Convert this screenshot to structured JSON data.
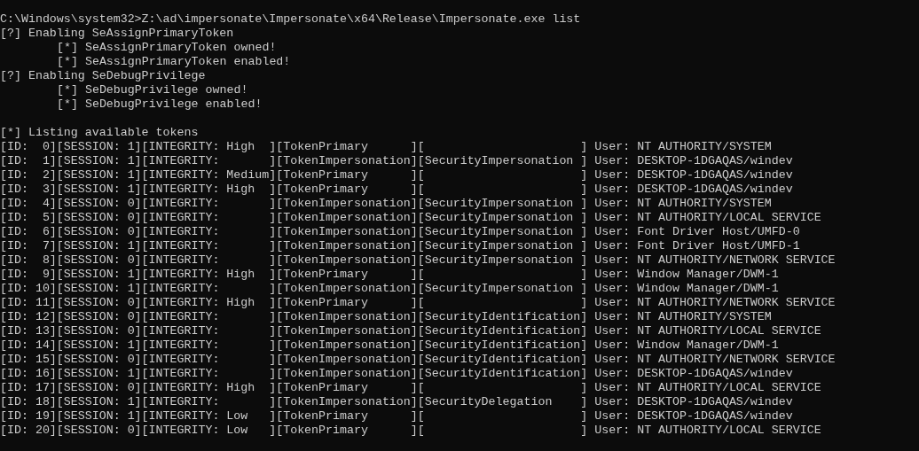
{
  "console": {
    "blocks": [
      {
        "lines": [
          {
            "text": "C:\\Windows\\system32>Z:\\ad\\impersonate\\Impersonate\\x64\\Release\\Impersonate.exe list",
            "indented": false
          },
          {
            "text": "[?] Enabling SeAssignPrimaryToken",
            "indented": false
          },
          {
            "text": "[*] SeAssignPrimaryToken owned!",
            "indented": true
          },
          {
            "text": "[*] SeAssignPrimaryToken enabled!",
            "indented": true
          },
          {
            "text": "[?] Enabling SeDebugPrivilege",
            "indented": false
          },
          {
            "text": "[*] SeDebugPrivilege owned!",
            "indented": true
          },
          {
            "text": "[*] SeDebugPrivilege enabled!",
            "indented": true
          }
        ]
      },
      {
        "lines": [
          {
            "text": "[*] Listing available tokens",
            "indented": false
          },
          {
            "text": "[ID:  0][SESSION: 1][INTEGRITY: High  ][TokenPrimary      ][                      ] User: NT AUTHORITY/SYSTEM",
            "indented": false
          },
          {
            "text": "[ID:  1][SESSION: 1][INTEGRITY:       ][TokenImpersonation][SecurityImpersonation ] User: DESKTOP-1DGAQAS/windev",
            "indented": false
          },
          {
            "text": "[ID:  2][SESSION: 1][INTEGRITY: Medium][TokenPrimary      ][                      ] User: DESKTOP-1DGAQAS/windev",
            "indented": false
          },
          {
            "text": "[ID:  3][SESSION: 1][INTEGRITY: High  ][TokenPrimary      ][                      ] User: DESKTOP-1DGAQAS/windev",
            "indented": false
          },
          {
            "text": "[ID:  4][SESSION: 0][INTEGRITY:       ][TokenImpersonation][SecurityImpersonation ] User: NT AUTHORITY/SYSTEM",
            "indented": false
          },
          {
            "text": "[ID:  5][SESSION: 0][INTEGRITY:       ][TokenImpersonation][SecurityImpersonation ] User: NT AUTHORITY/LOCAL SERVICE",
            "indented": false
          },
          {
            "text": "[ID:  6][SESSION: 0][INTEGRITY:       ][TokenImpersonation][SecurityImpersonation ] User: Font Driver Host/UMFD-0",
            "indented": false
          },
          {
            "text": "[ID:  7][SESSION: 1][INTEGRITY:       ][TokenImpersonation][SecurityImpersonation ] User: Font Driver Host/UMFD-1",
            "indented": false
          },
          {
            "text": "[ID:  8][SESSION: 0][INTEGRITY:       ][TokenImpersonation][SecurityImpersonation ] User: NT AUTHORITY/NETWORK SERVICE",
            "indented": false
          },
          {
            "text": "[ID:  9][SESSION: 1][INTEGRITY: High  ][TokenPrimary      ][                      ] User: Window Manager/DWM-1",
            "indented": false
          },
          {
            "text": "[ID: 10][SESSION: 1][INTEGRITY:       ][TokenImpersonation][SecurityImpersonation ] User: Window Manager/DWM-1",
            "indented": false
          },
          {
            "text": "[ID: 11][SESSION: 0][INTEGRITY: High  ][TokenPrimary      ][                      ] User: NT AUTHORITY/NETWORK SERVICE",
            "indented": false
          },
          {
            "text": "[ID: 12][SESSION: 0][INTEGRITY:       ][TokenImpersonation][SecurityIdentification] User: NT AUTHORITY/SYSTEM",
            "indented": false
          },
          {
            "text": "[ID: 13][SESSION: 0][INTEGRITY:       ][TokenImpersonation][SecurityIdentification] User: NT AUTHORITY/LOCAL SERVICE",
            "indented": false
          },
          {
            "text": "[ID: 14][SESSION: 1][INTEGRITY:       ][TokenImpersonation][SecurityIdentification] User: Window Manager/DWM-1",
            "indented": false
          },
          {
            "text": "[ID: 15][SESSION: 0][INTEGRITY:       ][TokenImpersonation][SecurityIdentification] User: NT AUTHORITY/NETWORK SERVICE",
            "indented": false
          },
          {
            "text": "[ID: 16][SESSION: 1][INTEGRITY:       ][TokenImpersonation][SecurityIdentification] User: DESKTOP-1DGAQAS/windev",
            "indented": false
          },
          {
            "text": "[ID: 17][SESSION: 0][INTEGRITY: High  ][TokenPrimary      ][                      ] User: NT AUTHORITY/LOCAL SERVICE",
            "indented": false
          },
          {
            "text": "[ID: 18][SESSION: 1][INTEGRITY:       ][TokenImpersonation][SecurityDelegation    ] User: DESKTOP-1DGAQAS/windev",
            "indented": false
          },
          {
            "text": "[ID: 19][SESSION: 1][INTEGRITY: Low   ][TokenPrimary      ][                      ] User: DESKTOP-1DGAQAS/windev",
            "indented": false
          },
          {
            "text": "[ID: 20][SESSION: 0][INTEGRITY: Low   ][TokenPrimary      ][                      ] User: NT AUTHORITY/LOCAL SERVICE",
            "indented": false
          }
        ]
      }
    ]
  }
}
